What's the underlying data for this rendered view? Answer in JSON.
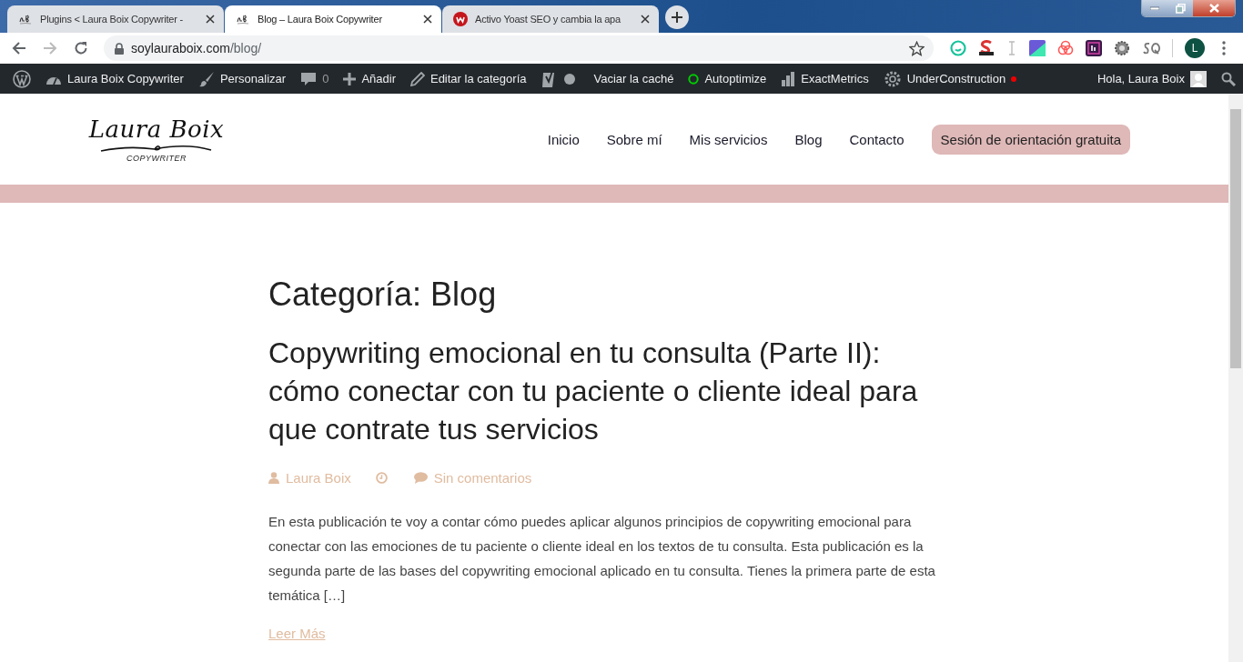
{
  "browser": {
    "tabs": [
      {
        "title": "Plugins < Laura Boix Copywriter -",
        "selected": false
      },
      {
        "title": "Blog – Laura Boix Copywriter",
        "selected": true
      },
      {
        "title": "Activo Yoast SEO y cambia la apa",
        "selected": false
      }
    ],
    "address": {
      "host": "soylauraboix.com",
      "path": "/blog/"
    },
    "profile": "L"
  },
  "admin_bar": {
    "items": [
      {
        "kind": "logo"
      },
      {
        "kind": "item",
        "label": "Laura Boix Copywriter"
      },
      {
        "kind": "item",
        "label": "Personalizar"
      },
      {
        "kind": "count",
        "label": "0"
      },
      {
        "kind": "item",
        "label": "Añadir"
      },
      {
        "kind": "item",
        "label": "Editar la categoría"
      },
      {
        "kind": "icon"
      },
      {
        "kind": "item",
        "label": "Vaciar la caché"
      },
      {
        "kind": "item",
        "label": "Autoptimize"
      },
      {
        "kind": "item",
        "label": "ExactMetrics"
      },
      {
        "kind": "item",
        "label": "UnderConstruction"
      }
    ],
    "greeting": "Hola, Laura Boix"
  },
  "site_header": {
    "logo": {
      "name": "Laura Boix",
      "tagline": "COPYWRITER"
    },
    "nav": [
      "Inicio",
      "Sobre mí",
      "Mis servicios",
      "Blog",
      "Contacto"
    ],
    "cta": "Sesión de orientación gratuita"
  },
  "archive": {
    "heading": "Categoría: Blog",
    "posts": [
      {
        "title": "Copywriting emocional en tu consulta (Parte II): cómo conectar con tu paciente o cliente ideal para que contrate tus servicios",
        "author": "Laura Boix",
        "comments": "Sin comentarios",
        "excerpt": "En esta publicación te voy a contar cómo puedes aplicar algunos principios de copywriting emocional para conectar con las emociones de tu paciente o cliente ideal en los textos de tu consulta. Esta publicación es la segunda parte de las bases del copywriting emocional aplicado en tu consulta. Tienes la primera parte de esta temática […]",
        "more": "Leer Más"
      }
    ]
  }
}
